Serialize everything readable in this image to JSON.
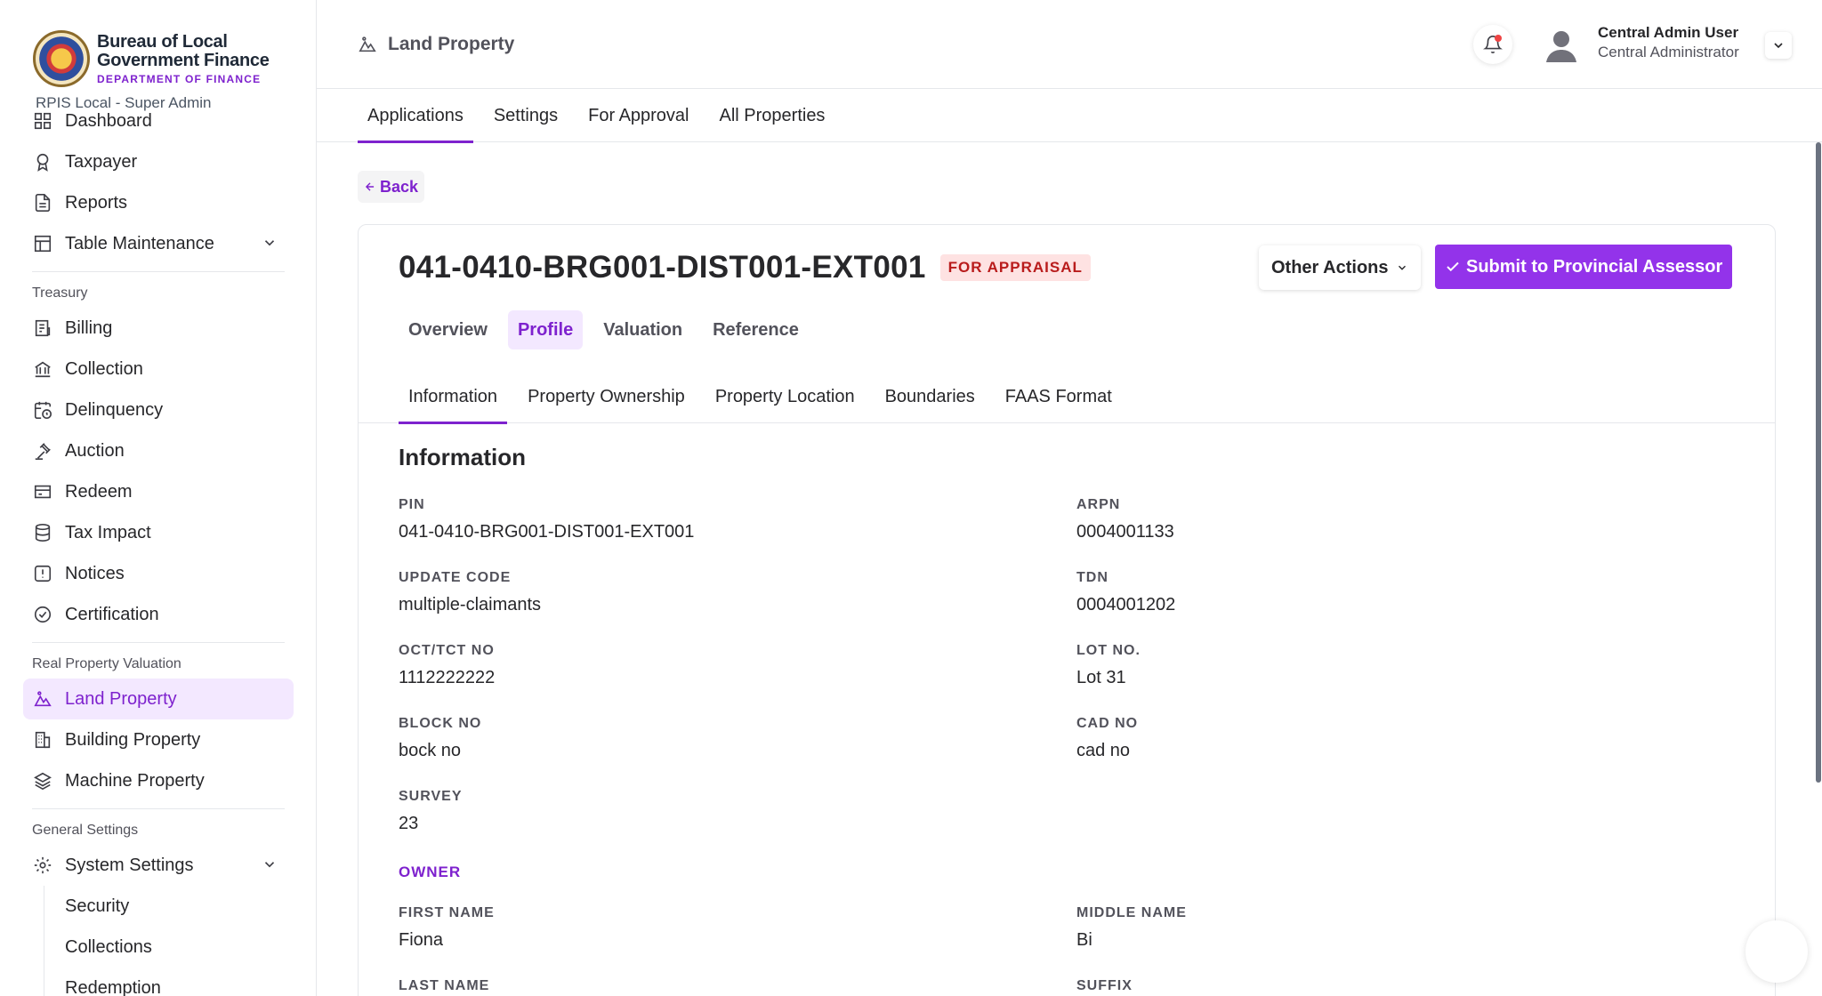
{
  "brand": {
    "title_line1": "Bureau of Local",
    "title_line2": "Government Finance",
    "subtitle": "DEPARTMENT OF FINANCE",
    "role": "RPIS Local - Super Admin"
  },
  "sidebar": {
    "items_top": [
      {
        "label": "Dashboard",
        "icon": "grid-icon"
      },
      {
        "label": "Taxpayer",
        "icon": "award-icon"
      },
      {
        "label": "Reports",
        "icon": "file-icon"
      },
      {
        "label": "Table Maintenance",
        "icon": "table-icon"
      }
    ],
    "section_treasury": "Treasury",
    "items_treasury": [
      {
        "label": "Billing",
        "icon": "receipt-icon"
      },
      {
        "label": "Collection",
        "icon": "bank-icon"
      },
      {
        "label": "Delinquency",
        "icon": "calendar-clock-icon"
      },
      {
        "label": "Auction",
        "icon": "gavel-icon"
      },
      {
        "label": "Redeem",
        "icon": "wallet-icon"
      },
      {
        "label": "Tax Impact",
        "icon": "database-icon"
      },
      {
        "label": "Notices",
        "icon": "alert-icon"
      },
      {
        "label": "Certification",
        "icon": "badge-check-icon"
      }
    ],
    "section_rpv": "Real Property Valuation",
    "items_rpv": [
      {
        "label": "Land Property",
        "icon": "mountain-icon"
      },
      {
        "label": "Building Property",
        "icon": "building-icon"
      },
      {
        "label": "Machine Property",
        "icon": "layers-icon"
      }
    ],
    "section_general": "General Settings",
    "system_settings": "System Settings",
    "sub_items": [
      "Security",
      "Collections",
      "Redemption"
    ]
  },
  "header": {
    "page_title": "Land Property",
    "user_name": "Central Admin User",
    "user_role": "Central Administrator"
  },
  "main_tabs": [
    "Applications",
    "Settings",
    "For Approval",
    "All Properties"
  ],
  "back_label": "Back",
  "record": {
    "id": "041-0410-BRG001-DIST001-EXT001",
    "status": "FOR APPRAISAL",
    "other_actions": "Other Actions",
    "submit": "Submit to Provincial Assessor"
  },
  "sub_tabs": [
    "Overview",
    "Profile",
    "Valuation",
    "Reference"
  ],
  "info_tabs": [
    "Information",
    "Property Ownership",
    "Property Location",
    "Boundaries",
    "FAAS Format"
  ],
  "information": {
    "title": "Information",
    "pin_label": "PIN",
    "pin": "041-0410-BRG001-DIST001-EXT001",
    "arpn_label": "ARPN",
    "arpn": "0004001133",
    "update_code_label": "UPDATE CODE",
    "update_code": "multiple-claimants",
    "tdn_label": "TDN",
    "tdn": "0004001202",
    "oct_label": "OCT/TCT NO",
    "oct": "1112222222",
    "lot_label": "LOT NO.",
    "lot": "Lot 31",
    "block_label": "BLOCK NO",
    "block": "bock no",
    "cad_label": "CAD NO",
    "cad": "cad no",
    "survey_label": "SURVEY",
    "survey": "23",
    "owner_label": "OWNER",
    "first_name_label": "FIRST NAME",
    "first_name": "Fiona",
    "middle_name_label": "MIDDLE NAME",
    "middle_name": "Bi",
    "last_name_label": "LAST NAME",
    "suffix_label": "SUFFIX"
  },
  "colors": {
    "accent": "#7e22ce",
    "accent_button": "#9333ea",
    "badge_bg": "#fee2e2",
    "badge_text": "#b91c1c"
  }
}
